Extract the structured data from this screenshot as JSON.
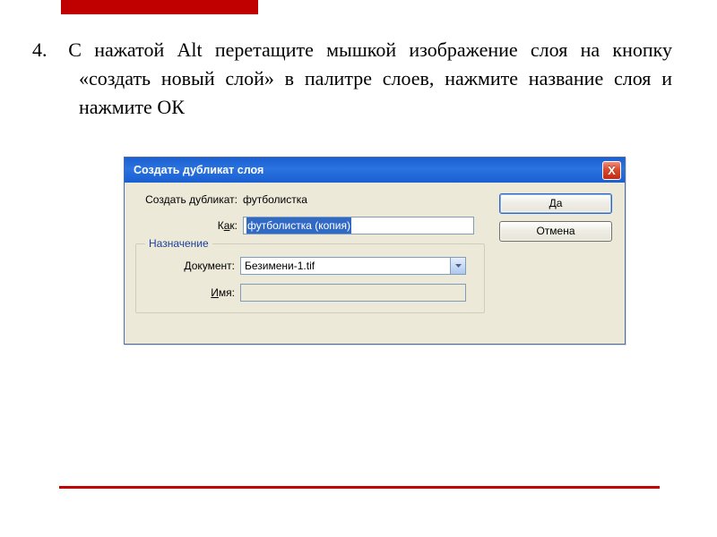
{
  "instruction": {
    "number": "4.",
    "text": "С нажатой Alt перетащите мышкой изображение слоя на кнопку «создать новый слой» в палитре слоев, нажмите название слоя и нажмите ОК"
  },
  "dialog": {
    "title": "Создать дубликат слоя",
    "close_symbol": "X",
    "duplicate_label": "Создать дубликат:",
    "duplicate_value": "футболистка",
    "as_label_pre": "К",
    "as_label_u": "а",
    "as_label_post": "к:",
    "as_value": "футболистка (копия)",
    "fieldset_legend": "Назначение",
    "doc_label_pre": "",
    "doc_label_u": "Д",
    "doc_label_post": "окумент:",
    "doc_value": "Безимени-1.tif",
    "name_label_pre": "",
    "name_label_u": "И",
    "name_label_post": "мя:",
    "name_value": "",
    "ok_label": "Да",
    "cancel_label": "Отмена"
  }
}
